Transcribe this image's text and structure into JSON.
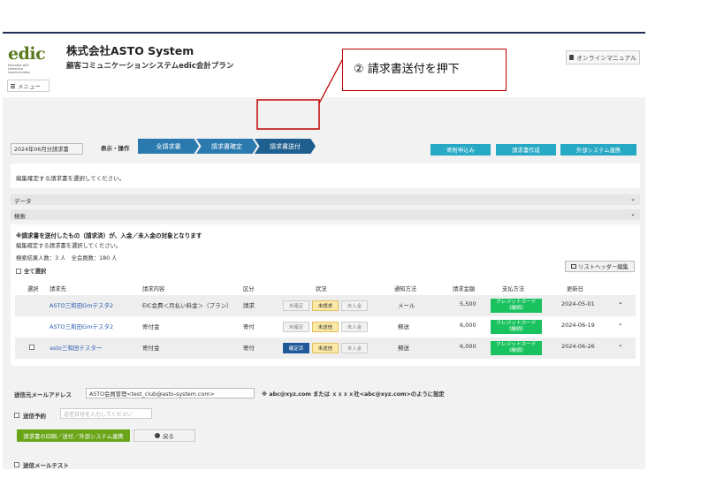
{
  "header": {
    "logo_word": "edic",
    "logo_sub": "Education with\nInteractive\nCommunication",
    "company": "株式会社ASTO System",
    "system": "顧客コミュニケーションシステムedic会計プラン",
    "menu_label": "メニュー",
    "manual_label": "オンラインマニュアル"
  },
  "annotation": {
    "text": "② 請求書送付を押下"
  },
  "toolbar": {
    "month": "2024年06月分請求書",
    "op_label": "表示・操作",
    "steps": [
      "全請求書",
      "請求書確定",
      "請求書送付"
    ],
    "actions": [
      "寄附申込み",
      "請求書作成",
      "外部システム連携"
    ]
  },
  "panel": {
    "message": "編集確定する請求書を選択してください。"
  },
  "accordions": [
    "データ",
    "検索"
  ],
  "list": {
    "notice": "※請求書を送付したもの（請求済）が、入金／未入金の対象となります",
    "sub1": "編集確定する請求書を選択してください。",
    "sub2": "検索結果人数：3 人　全会員数：180 人",
    "select_all": "全て選択",
    "list_header_btn": "リストヘッダー編集",
    "columns": [
      "選択",
      "請求先",
      "請求内容",
      "区分",
      "状況",
      "通知方法",
      "請求金額",
      "支払方法",
      "更新日"
    ],
    "rows": [
      {
        "name": "ASTO三和田Gmテスタ2",
        "content": "EIC会費＜月払い料金＞（プラン）",
        "kubun": "請求",
        "s1": "未確定",
        "s2": "未請求",
        "s3": "未入金",
        "method": "メール",
        "amount": "5,500",
        "pay": "クレジットカード\n(継続)",
        "date": "2024-05-01"
      },
      {
        "name": "ASTO三和田Gmテスタ2",
        "content": "寄付金",
        "kubun": "寄付",
        "s1": "未確定",
        "s2": "未送信",
        "s3": "未入金",
        "method": "郵送",
        "amount": "6,000",
        "pay": "クレジットカード\n(継続)",
        "date": "2024-06-19"
      },
      {
        "name": "asto三和田テスター",
        "content": "寄付金",
        "kubun": "寄付",
        "s1": "確定済",
        "s2": "未送信",
        "s3": "未入金",
        "method": "郵送",
        "amount": "6,000",
        "pay": "クレジットカード\n(継続)",
        "date": "2024-06-26"
      }
    ]
  },
  "send": {
    "email_label": "送信元メールアドレス",
    "email_value": "ASTO会員管理<test_club@asto-system.com>",
    "email_note": "※ abc@xyz.com または ｘｘｘｘ社<abc@xyz.com>のように設定",
    "schedule_label": "送信予約",
    "schedule_placeholder": "送信日付を入力してください",
    "primary_btn": "請求書の印刷／送付／外部システム連携",
    "back_btn": "戻る",
    "test_label": "送信メールテスト"
  },
  "colors": {
    "navy": "#1f2d55",
    "step_blue": "#2a7ab0",
    "action_teal": "#27a8c4",
    "green": "#6aa519",
    "pay_green": "#19c25e",
    "callout_red": "#c00000"
  }
}
